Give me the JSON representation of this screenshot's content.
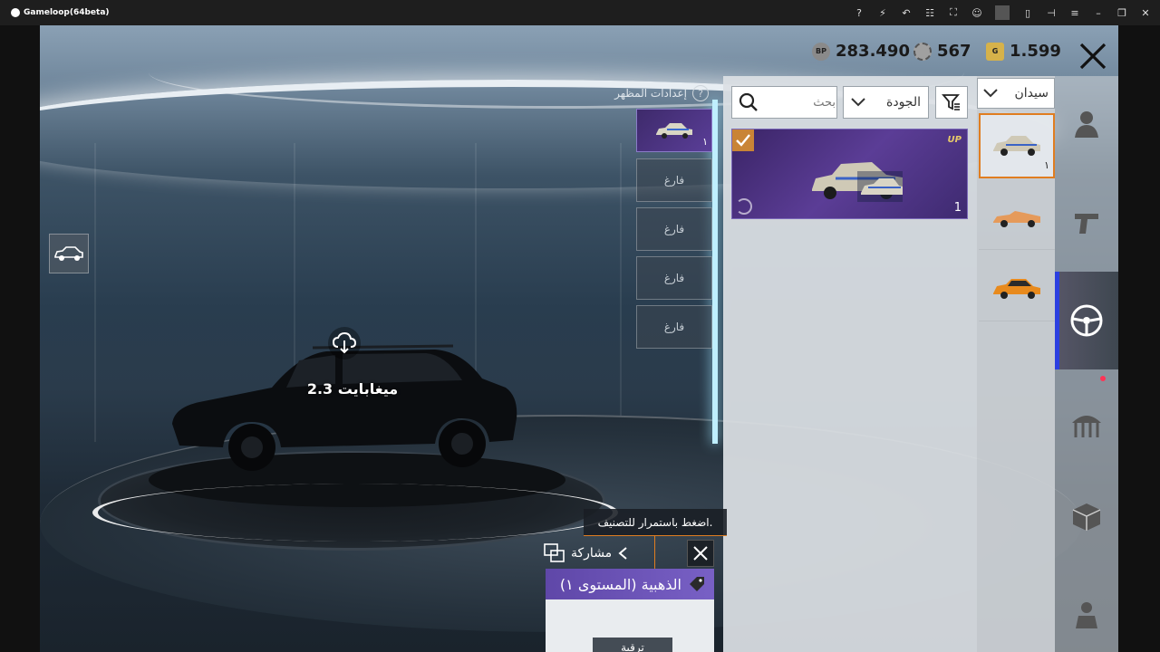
{
  "window": {
    "title": "Gameloop(64beta)"
  },
  "currencies": [
    {
      "icon": "bp-coin-icon",
      "badge": "BP",
      "value": "283.490",
      "color": "#8a8a8a"
    },
    {
      "icon": "silver-fragment-icon",
      "badge": "",
      "value": "567",
      "color": "#a0a0a0"
    },
    {
      "icon": "g-coin-icon",
      "badge": "G",
      "value": "1.599",
      "color": "#d6b24a"
    }
  ],
  "appearance": {
    "title": "إعدادات المظهر",
    "slots": [
      {
        "label": "",
        "num": "١"
      },
      {
        "label": "فارغ"
      },
      {
        "label": "فارغ"
      },
      {
        "label": "فارغ"
      },
      {
        "label": "فارغ"
      }
    ]
  },
  "download": {
    "size": "2.3 ميغابايت"
  },
  "filters": {
    "search_placeholder": "بحث",
    "quality_label": "الجودة",
    "vehicle_type": "سيدان"
  },
  "selected_item": {
    "logo": "UP",
    "num": "1"
  },
  "categories": [
    {
      "num": "١"
    },
    {
      "num": ""
    },
    {
      "num": ""
    }
  ],
  "tooltip": {
    "text": "اضغط باستمرار للتصنيف."
  },
  "share": {
    "label": "مشاركة"
  },
  "item_info": {
    "title": "الذهبية (المستوى ١)",
    "button": "ترقية"
  },
  "colors": {
    "accent": "#e07d20",
    "purple": "#5b3d96",
    "active_bar": "#2b3fe0"
  }
}
